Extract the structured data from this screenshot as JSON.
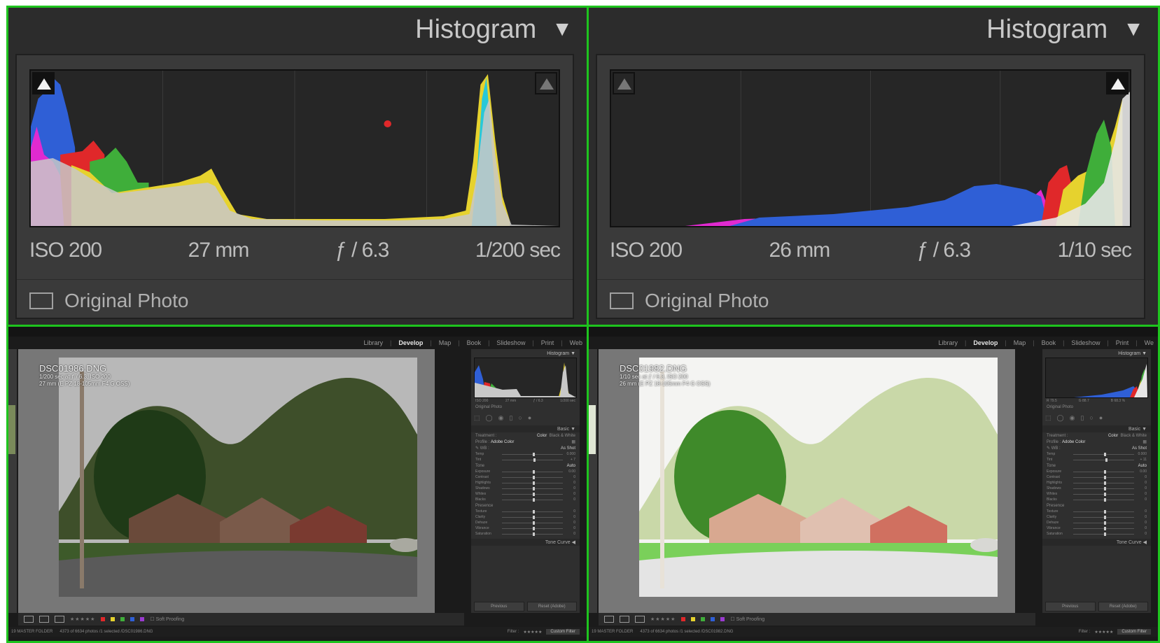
{
  "panels": [
    {
      "title": "Histogram",
      "exif": {
        "iso": "ISO 200",
        "focal": "27 mm",
        "aperture": "ƒ / 6.3",
        "shutter": "1/200 sec"
      },
      "original_photo_label": "Original Photo",
      "shadow_clip_active": true,
      "highlight_clip_active": false
    },
    {
      "title": "Histogram",
      "exif": {
        "iso": "ISO 200",
        "focal": "26 mm",
        "aperture": "ƒ / 6.3",
        "shutter": "1/10 sec"
      },
      "original_photo_label": "Original Photo",
      "shadow_clip_active": false,
      "highlight_clip_active": true
    }
  ],
  "windows": [
    {
      "modules": [
        "Library",
        "Develop",
        "Map",
        "Book",
        "Slideshow",
        "Print",
        "Web"
      ],
      "active_module": "Develop",
      "photo": {
        "filename": "DSC01986.DNG",
        "line1": "1/200 sec at ƒ / 6.3, ISO 200",
        "line2": "27 mm (E PZ 18-105mm F4 G OSS)"
      },
      "right_panel": {
        "histogram_label": "Histogram",
        "mini_exif": [
          "ISO 200",
          "27 mm",
          "ƒ / 6.3",
          "1/200 sec"
        ],
        "original_photo": "Original Photo",
        "basic_label": "Basic",
        "treatment_label": "Treatment :",
        "treatment_color": "Color",
        "treatment_bw": "Black & White",
        "profile_label": "Profile :",
        "profile_value": "Adobe Color",
        "wb_label": "WB :",
        "wb_value": "As Shot",
        "tone_label": "Tone",
        "auto_label": "Auto",
        "presence_label": "Presence",
        "sliders_wb": [
          {
            "label": "Temp",
            "value": "0.000",
            "pos": 0.5
          },
          {
            "label": "Tint",
            "value": "+ 7",
            "pos": 0.52
          }
        ],
        "sliders_tone": [
          {
            "label": "Exposure",
            "value": "0.00",
            "pos": 0.5
          },
          {
            "label": "Contrast",
            "value": "0",
            "pos": 0.5
          },
          {
            "label": "Highlights",
            "value": "0",
            "pos": 0.5
          },
          {
            "label": "Shadows",
            "value": "0",
            "pos": 0.5
          },
          {
            "label": "Whites",
            "value": "0",
            "pos": 0.5
          },
          {
            "label": "Blacks",
            "value": "0",
            "pos": 0.5
          }
        ],
        "sliders_presence": [
          {
            "label": "Texture",
            "value": "0",
            "pos": 0.5
          },
          {
            "label": "Clarity",
            "value": "0",
            "pos": 0.5
          },
          {
            "label": "Dehaze",
            "value": "0",
            "pos": 0.5
          },
          {
            "label": "Vibrance",
            "value": "0",
            "pos": 0.5
          },
          {
            "label": "Saturation",
            "value": "0",
            "pos": 0.5
          }
        ],
        "tone_curve_label": "Tone Curve",
        "previous_button": "Previous",
        "reset_button": "Reset (Adobe)"
      },
      "toolbar": {
        "stars": "★★★★★",
        "soft_proofing": "Soft Proofing"
      },
      "filmstrip": {
        "folder": "19 MASTER FOLDER",
        "count": "4373 of 6634 photos /1 selected /DSC01986.DNG",
        "filter_label": "Filter :",
        "filter_stars": "★★★★★",
        "custom_filter": "Custom Filter"
      },
      "light": false
    },
    {
      "modules": [
        "Library",
        "Develop",
        "Map",
        "Book",
        "Slideshow",
        "Print",
        "We"
      ],
      "active_module": "Develop",
      "photo": {
        "filename": "DSC01982.DNG",
        "line1": "1/10 sec at ƒ / 6.3, ISO 200",
        "line2": "26 mm (E PZ 18-105mm F4 G OSS)"
      },
      "right_panel": {
        "histogram_label": "Histogram",
        "mini_exif": [
          "R 79.5",
          "G 88.7",
          "B 68.3 %",
          ""
        ],
        "original_photo": "Original Photo",
        "basic_label": "Basic",
        "treatment_label": "Treatment :",
        "treatment_color": "Color",
        "treatment_bw": "Black & White",
        "profile_label": "Profile :",
        "profile_value": "Adobe Color",
        "wb_label": "WB :",
        "wb_value": "As Shot",
        "tone_label": "Tone",
        "auto_label": "Auto",
        "presence_label": "Presence",
        "sliders_wb": [
          {
            "label": "Temp",
            "value": "0.000",
            "pos": 0.5
          },
          {
            "label": "Tint",
            "value": "+ 11",
            "pos": 0.53
          }
        ],
        "sliders_tone": [
          {
            "label": "Exposure",
            "value": "0.00",
            "pos": 0.5
          },
          {
            "label": "Contrast",
            "value": "0",
            "pos": 0.5
          },
          {
            "label": "Highlights",
            "value": "0",
            "pos": 0.5
          },
          {
            "label": "Shadows",
            "value": "0",
            "pos": 0.5
          },
          {
            "label": "Whites",
            "value": "0",
            "pos": 0.5
          },
          {
            "label": "Blacks",
            "value": "0",
            "pos": 0.5
          }
        ],
        "sliders_presence": [
          {
            "label": "Texture",
            "value": "0",
            "pos": 0.5
          },
          {
            "label": "Clarity",
            "value": "0",
            "pos": 0.5
          },
          {
            "label": "Dehaze",
            "value": "0",
            "pos": 0.5
          },
          {
            "label": "Vibrance",
            "value": "0",
            "pos": 0.5
          },
          {
            "label": "Saturation",
            "value": "0",
            "pos": 0.5
          }
        ],
        "tone_curve_label": "Tone Curve",
        "previous_button": "Previous",
        "reset_button": "Reset (Adobe)"
      },
      "toolbar": {
        "stars": "★★★★★",
        "soft_proofing": "Soft Proofing"
      },
      "filmstrip": {
        "folder": "19 MASTER FOLDER",
        "count": "4373 of 6634 photos /1 selected /DSC01982.DNG",
        "filter_label": "Filter :",
        "filter_stars": "★★★★★",
        "custom_filter": "Custom Filter"
      },
      "light": true
    }
  ],
  "colors": {
    "border_green": "#1ec41e",
    "panel_bg": "#2c2c2c",
    "red": "#e0282a",
    "green": "#3fae3a",
    "blue": "#2f5fd6",
    "yellow": "#e6d22e",
    "magenta": "#e02ad0",
    "cyan": "#28c8d8"
  }
}
